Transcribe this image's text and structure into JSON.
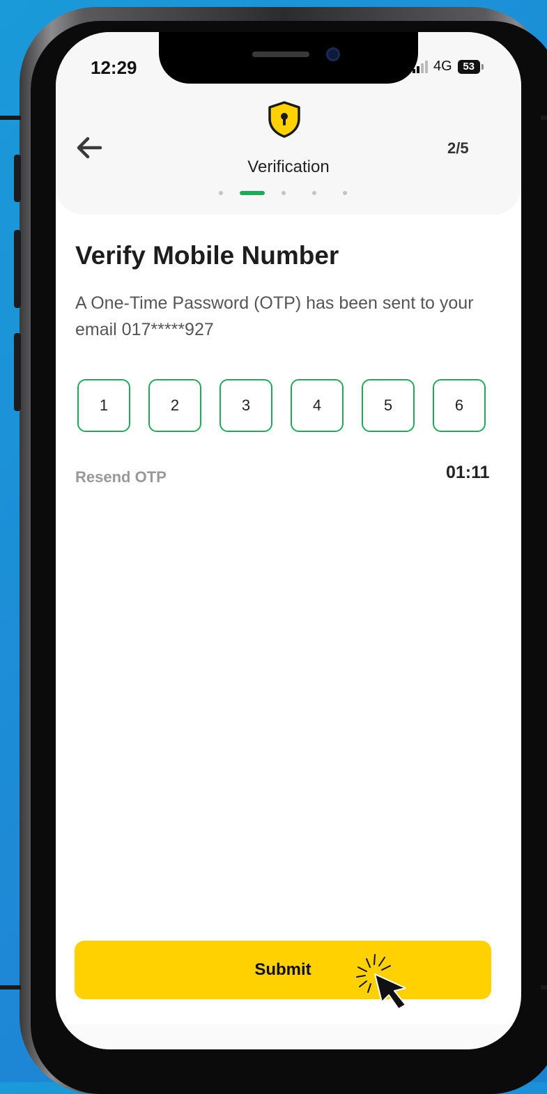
{
  "status_bar": {
    "time": "12:29",
    "network": "4G",
    "battery": "53"
  },
  "header": {
    "title": "Verification",
    "step": "2/5",
    "progress": {
      "current_step": 2,
      "total_steps": 5
    },
    "icon": "shield-keyhole-icon",
    "back_icon": "back-arrow-icon"
  },
  "main": {
    "title": "Verify Mobile Number",
    "description": "A One-Time Password (OTP) has been sent to your email 017*****927",
    "otp_digits": [
      "1",
      "2",
      "3",
      "4",
      "5",
      "6"
    ],
    "resend_label": "Resend OTP",
    "timer": "01:11"
  },
  "footer": {
    "submit_label": "Submit"
  },
  "colors": {
    "accent_green": "#1faa5a",
    "button_yellow": "#ffd100",
    "shield_yellow": "#ffd100",
    "background_blue": "#1e8fd8"
  }
}
